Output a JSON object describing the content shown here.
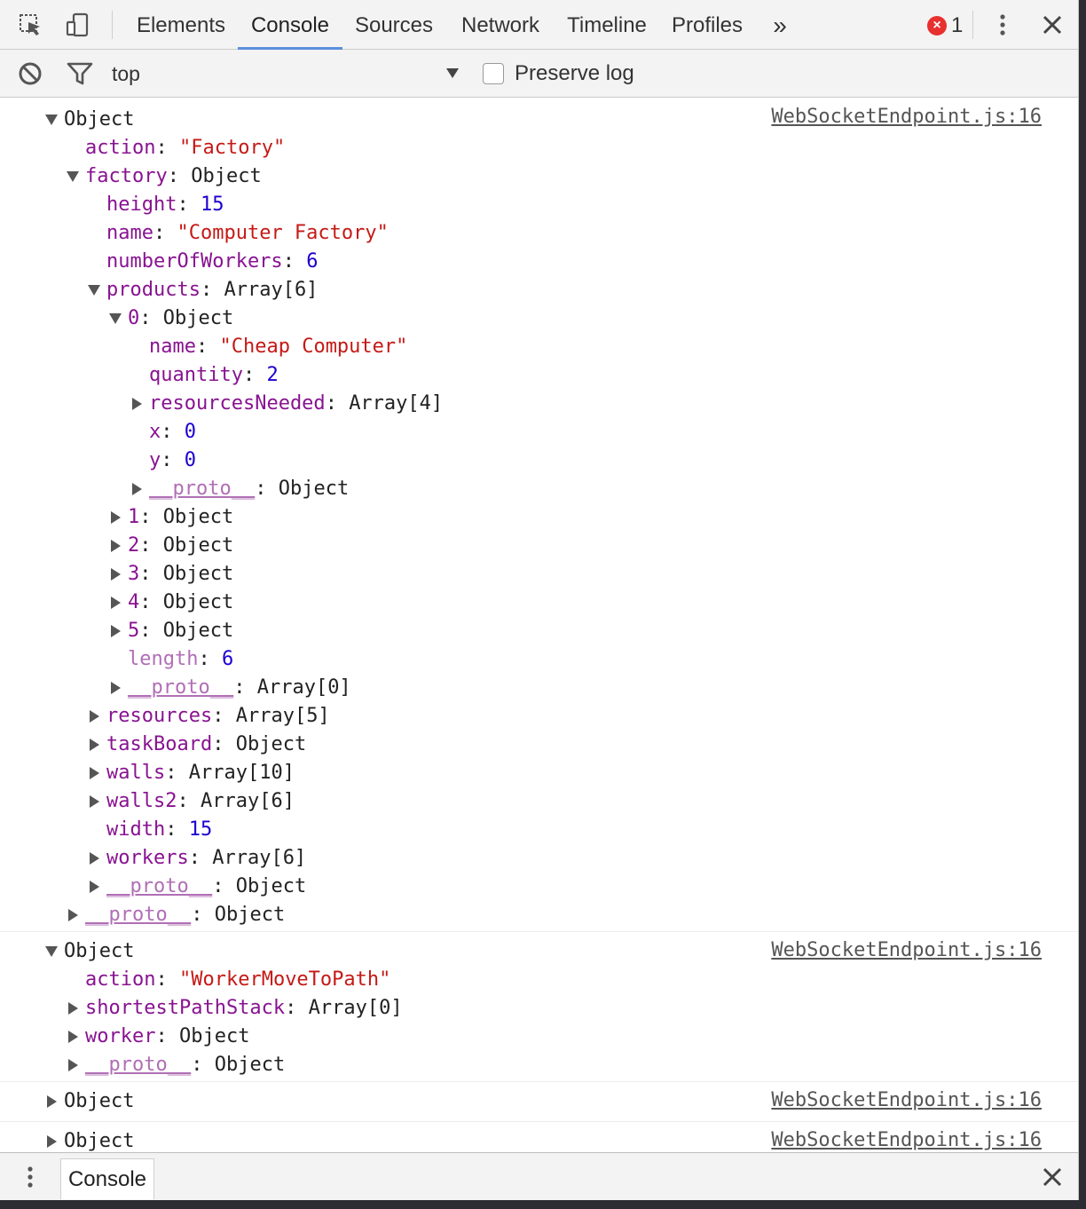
{
  "tabs": [
    {
      "label": "Elements"
    },
    {
      "label": "Console",
      "active": true
    },
    {
      "label": "Sources"
    },
    {
      "label": "Network"
    },
    {
      "label": "Timeline"
    },
    {
      "label": "Profiles"
    }
  ],
  "overflow_glyph": "»",
  "error_count": "1",
  "toolbar": {
    "context": "top",
    "preserve_log_label": "Preserve log",
    "preserve_log_checked": false
  },
  "messages": [
    {
      "source": "WebSocketEndpoint.js:16",
      "lines": [
        {
          "indent": 0,
          "arrow": "down",
          "key": "",
          "sep": "",
          "value": "Object",
          "vtype": "plain"
        },
        {
          "indent": 1,
          "arrow": "none",
          "key": "action",
          "sep": ": ",
          "value": "\"Factory\"",
          "vtype": "string"
        },
        {
          "indent": 1,
          "arrow": "down",
          "key": "factory",
          "sep": ": ",
          "value": "Object",
          "vtype": "plain"
        },
        {
          "indent": 2,
          "arrow": "none",
          "key": "height",
          "sep": ": ",
          "value": "15",
          "vtype": "number"
        },
        {
          "indent": 2,
          "arrow": "none",
          "key": "name",
          "sep": ": ",
          "value": "\"Computer Factory\"",
          "vtype": "string"
        },
        {
          "indent": 2,
          "arrow": "none",
          "key": "numberOfWorkers",
          "sep": ": ",
          "value": "6",
          "vtype": "number"
        },
        {
          "indent": 2,
          "arrow": "down",
          "key": "products",
          "sep": ": ",
          "value": "Array[6]",
          "vtype": "plain"
        },
        {
          "indent": 3,
          "arrow": "down",
          "key": "0",
          "sep": ": ",
          "value": "Object",
          "vtype": "plain"
        },
        {
          "indent": 4,
          "arrow": "none",
          "key": "name",
          "sep": ": ",
          "value": "\"Cheap Computer\"",
          "vtype": "string"
        },
        {
          "indent": 4,
          "arrow": "none",
          "key": "quantity",
          "sep": ": ",
          "value": "2",
          "vtype": "number"
        },
        {
          "indent": 4,
          "arrow": "right",
          "key": "resourcesNeeded",
          "sep": ": ",
          "value": "Array[4]",
          "vtype": "plain"
        },
        {
          "indent": 4,
          "arrow": "none",
          "key": "x",
          "sep": ": ",
          "value": "0",
          "vtype": "number"
        },
        {
          "indent": 4,
          "arrow": "none",
          "key": "y",
          "sep": ": ",
          "value": "0",
          "vtype": "number"
        },
        {
          "indent": 4,
          "arrow": "right",
          "key": "__proto__",
          "sep": ": ",
          "value": "Object",
          "vtype": "plain",
          "dim": true
        },
        {
          "indent": 3,
          "arrow": "right",
          "key": "1",
          "sep": ": ",
          "value": "Object",
          "vtype": "plain"
        },
        {
          "indent": 3,
          "arrow": "right",
          "key": "2",
          "sep": ": ",
          "value": "Object",
          "vtype": "plain"
        },
        {
          "indent": 3,
          "arrow": "right",
          "key": "3",
          "sep": ": ",
          "value": "Object",
          "vtype": "plain"
        },
        {
          "indent": 3,
          "arrow": "right",
          "key": "4",
          "sep": ": ",
          "value": "Object",
          "vtype": "plain"
        },
        {
          "indent": 3,
          "arrow": "right",
          "key": "5",
          "sep": ": ",
          "value": "Object",
          "vtype": "plain"
        },
        {
          "indent": 3,
          "arrow": "none",
          "key": "length",
          "sep": ": ",
          "value": "6",
          "vtype": "number",
          "dim": true
        },
        {
          "indent": 3,
          "arrow": "right",
          "key": "__proto__",
          "sep": ": ",
          "value": "Array[0]",
          "vtype": "plain",
          "dim": true
        },
        {
          "indent": 2,
          "arrow": "right",
          "key": "resources",
          "sep": ": ",
          "value": "Array[5]",
          "vtype": "plain"
        },
        {
          "indent": 2,
          "arrow": "right",
          "key": "taskBoard",
          "sep": ": ",
          "value": "Object",
          "vtype": "plain"
        },
        {
          "indent": 2,
          "arrow": "right",
          "key": "walls",
          "sep": ": ",
          "value": "Array[10]",
          "vtype": "plain"
        },
        {
          "indent": 2,
          "arrow": "right",
          "key": "walls2",
          "sep": ": ",
          "value": "Array[6]",
          "vtype": "plain"
        },
        {
          "indent": 2,
          "arrow": "none",
          "key": "width",
          "sep": ": ",
          "value": "15",
          "vtype": "number"
        },
        {
          "indent": 2,
          "arrow": "right",
          "key": "workers",
          "sep": ": ",
          "value": "Array[6]",
          "vtype": "plain"
        },
        {
          "indent": 2,
          "arrow": "right",
          "key": "__proto__",
          "sep": ": ",
          "value": "Object",
          "vtype": "plain",
          "dim": true
        },
        {
          "indent": 1,
          "arrow": "right",
          "key": "__proto__",
          "sep": ": ",
          "value": "Object",
          "vtype": "plain",
          "dim": true
        }
      ]
    },
    {
      "source": "WebSocketEndpoint.js:16",
      "lines": [
        {
          "indent": 0,
          "arrow": "down",
          "key": "",
          "sep": "",
          "value": "Object",
          "vtype": "plain"
        },
        {
          "indent": 1,
          "arrow": "none",
          "key": "action",
          "sep": ": ",
          "value": "\"WorkerMoveToPath\"",
          "vtype": "string"
        },
        {
          "indent": 1,
          "arrow": "right",
          "key": "shortestPathStack",
          "sep": ": ",
          "value": "Array[0]",
          "vtype": "plain"
        },
        {
          "indent": 1,
          "arrow": "right",
          "key": "worker",
          "sep": ": ",
          "value": "Object",
          "vtype": "plain"
        },
        {
          "indent": 1,
          "arrow": "right",
          "key": "__proto__",
          "sep": ": ",
          "value": "Object",
          "vtype": "plain",
          "dim": true
        }
      ]
    },
    {
      "source": "WebSocketEndpoint.js:16",
      "lines": [
        {
          "indent": 0,
          "arrow": "right",
          "key": "",
          "sep": "",
          "value": "Object",
          "vtype": "plain"
        }
      ]
    },
    {
      "source": "WebSocketEndpoint.js:16",
      "lines": [
        {
          "indent": 0,
          "arrow": "right",
          "key": "",
          "sep": "",
          "value": "Object",
          "vtype": "plain"
        }
      ]
    }
  ],
  "drawer": {
    "tab_label": "Console"
  },
  "colors": {
    "key": "#881391",
    "string": "#c41a16",
    "number": "#1c00cf",
    "active_tab": "#5b8fdc",
    "error_badge": "#e8302f"
  },
  "icons": {
    "inspect": "inspect-element-icon",
    "device": "device-mode-icon",
    "clear": "clear-console-icon",
    "filter": "filter-icon",
    "menu": "kebab-menu-icon",
    "close": "close-icon"
  }
}
